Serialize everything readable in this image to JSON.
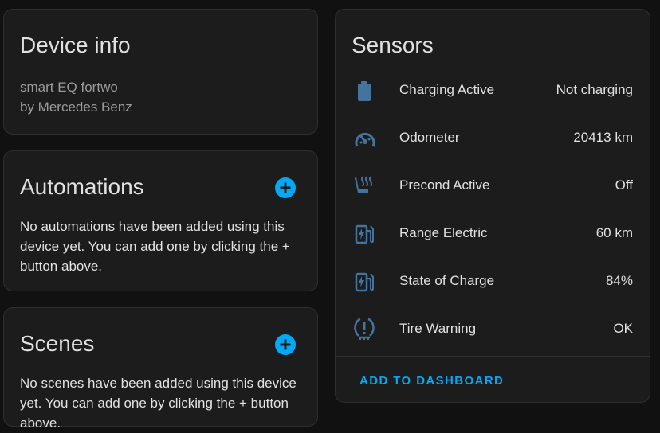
{
  "device_info": {
    "title": "Device info",
    "model": "smart EQ fortwo",
    "manufacturer": "by Mercedes Benz"
  },
  "automations": {
    "title": "Automations",
    "empty_text": "No automations have been added using this device yet. You can add one by clicking the + button above."
  },
  "scenes": {
    "title": "Scenes",
    "empty_text": "No scenes have been added using this device yet. You can add one by clicking the + button above."
  },
  "sensors": {
    "title": "Sensors",
    "items": [
      {
        "name": "Charging Active",
        "value": "Not charging",
        "icon": "battery-icon"
      },
      {
        "name": "Odometer",
        "value": "20413 km",
        "icon": "speedometer-icon"
      },
      {
        "name": "Precond Active",
        "value": "Off",
        "icon": "seat-heater-icon"
      },
      {
        "name": "Range Electric",
        "value": "60 km",
        "icon": "ev-station-icon"
      },
      {
        "name": "State of Charge",
        "value": "84%",
        "icon": "ev-station-icon"
      },
      {
        "name": "Tire Warning",
        "value": "OK",
        "icon": "tire-alert-icon"
      }
    ],
    "add_to_dashboard": "ADD TO DASHBOARD"
  },
  "colors": {
    "accent": "#03a9f4",
    "icon": "#44739e",
    "card_bg": "#1c1c1c",
    "page_bg": "#111111"
  }
}
